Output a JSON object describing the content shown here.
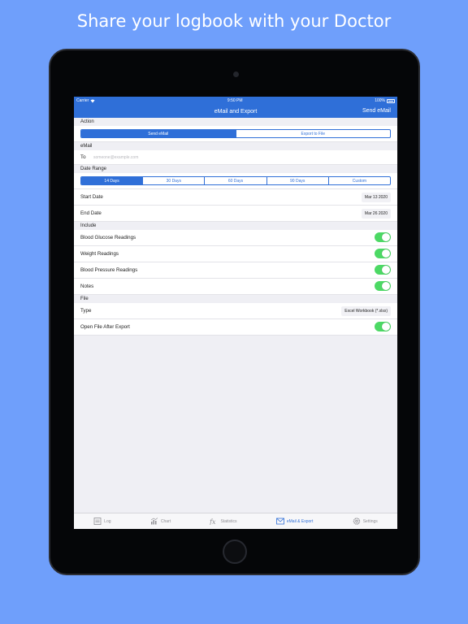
{
  "headline": "Share your logbook with your Doctor",
  "status_bar": {
    "carrier": "Carrier",
    "time": "9:50 PM",
    "battery": "100%"
  },
  "nav": {
    "title": "eMail and Export",
    "action": "Send eMail"
  },
  "action_section": {
    "header": "Action",
    "options": [
      "Send eMail",
      "Export to File"
    ],
    "selected": "Send eMail"
  },
  "email_section": {
    "header": "eMail",
    "to_label": "To",
    "to_placeholder": "someone@example.com",
    "to_value": ""
  },
  "date_range": {
    "header": "Date Range",
    "options": [
      "14 Days",
      "30 Days",
      "60 Days",
      "90 Days",
      "Custom"
    ],
    "selected": "14 Days",
    "start_label": "Start Date",
    "start_value": "Mar 13 2020",
    "end_label": "End Date",
    "end_value": "Mar 26 2020"
  },
  "include": {
    "header": "Include",
    "items": [
      {
        "label": "Blood Glucose Readings",
        "on": true
      },
      {
        "label": "Weight Readings",
        "on": true
      },
      {
        "label": "Blood Pressure Readings",
        "on": true
      },
      {
        "label": "Notes",
        "on": true
      }
    ]
  },
  "file": {
    "header": "File",
    "type_label": "Type",
    "type_value": "Excel Workbook (*.xlsx)",
    "open_label": "Open File After Export",
    "open_on": true
  },
  "tabbar": {
    "items": [
      {
        "label": "Log",
        "icon": "log-icon"
      },
      {
        "label": "Chart",
        "icon": "chart-icon"
      },
      {
        "label": "Statistics",
        "icon": "fx-icon"
      },
      {
        "label": "eMail & Export",
        "icon": "envelope-icon"
      },
      {
        "label": "Settings",
        "icon": "gear-icon"
      }
    ],
    "active": "eMail & Export"
  },
  "colors": {
    "background": "#6f9ffb",
    "accent": "#2f6fd8",
    "toggle_on": "#4cd964"
  }
}
